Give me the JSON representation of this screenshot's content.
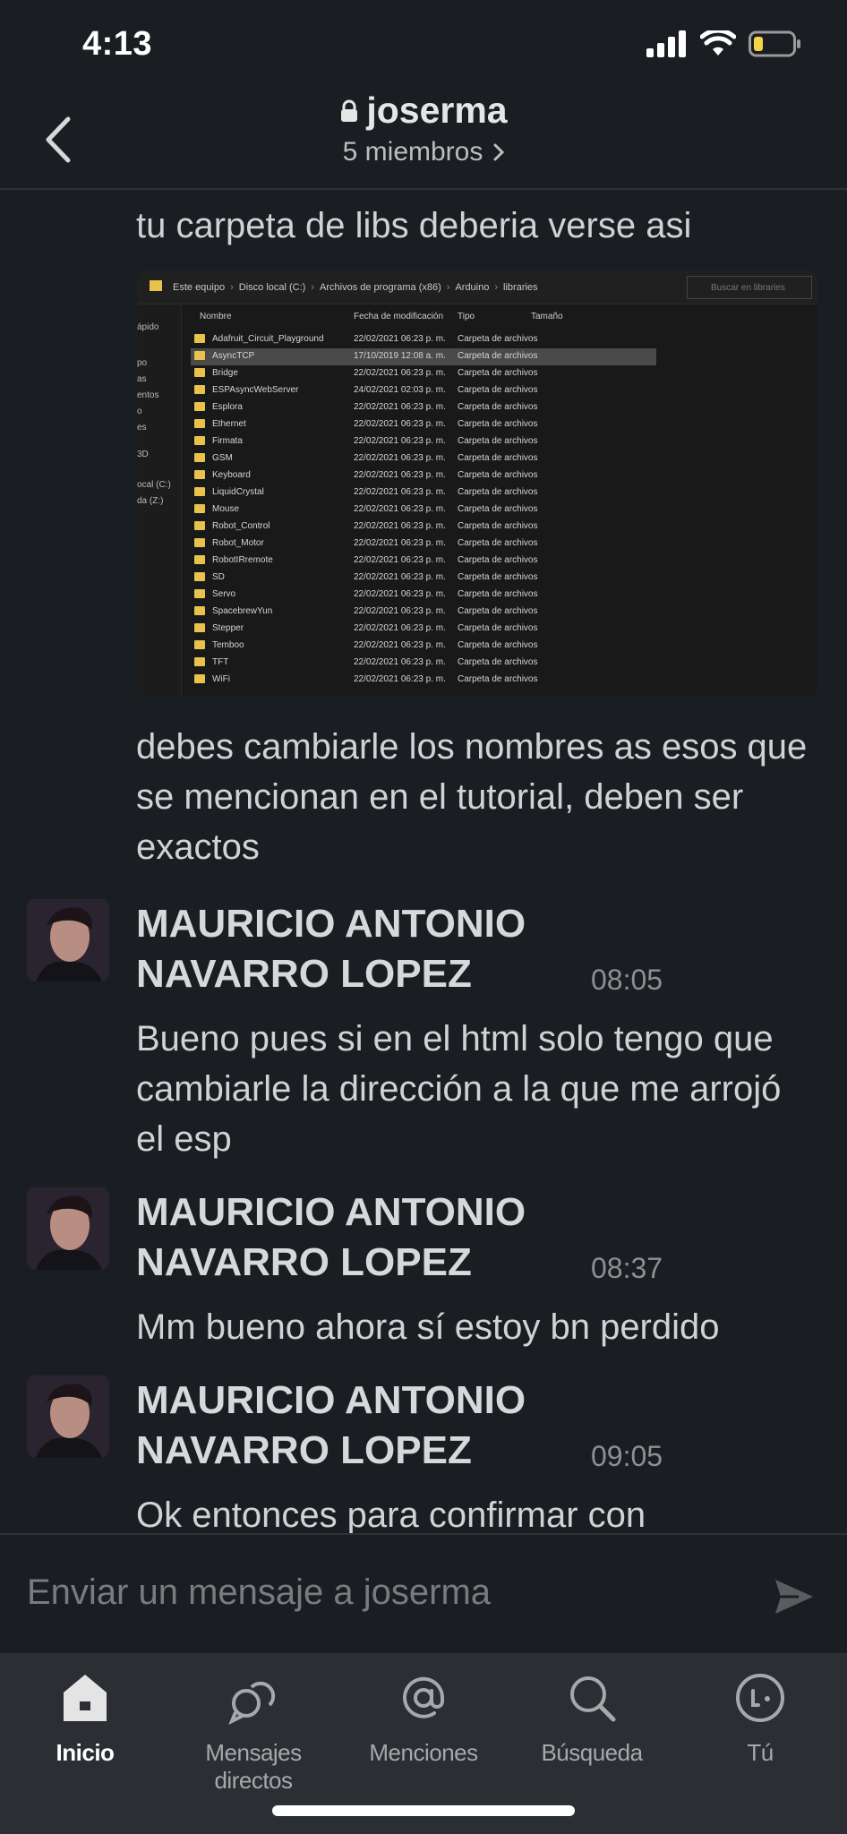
{
  "status_bar": {
    "time": "4:13"
  },
  "header": {
    "channel_name": "joserma",
    "members": "5 miembros"
  },
  "messages": {
    "m1_text": "tu carpeta de libs  deberia verse asi",
    "m2_text": "debes cambiarle los nombres as esos que se mencionan en el tutorial, deben ser exactos",
    "m3": {
      "sender": "MAURICIO ANTONIO NAVARRO LOPEZ",
      "time": "08:05",
      "text": "Bueno pues si en el html solo tengo que cambiarle la dirección a la que me arrojó el esp"
    },
    "m4": {
      "sender": "MAURICIO ANTONIO NAVARRO LOPEZ",
      "time": "08:37",
      "text": "Mm bueno ahora sí estoy bn perdido"
    },
    "m5": {
      "sender": "MAURICIO ANTONIO NAVARRO LOPEZ",
      "time": "09:05",
      "text": "Ok entonces para confirmar con"
    }
  },
  "explorer": {
    "breadcrumb": [
      "Este equipo",
      "Disco local (C:)",
      "Archivos de programa (x86)",
      "Arduino",
      "libraries"
    ],
    "search_placeholder": "Buscar en libraries",
    "nav_items": [
      "ápido",
      "po",
      "as",
      "entos",
      "o",
      "es",
      "3D",
      "ocal (C:)",
      "da (Z:)"
    ],
    "columns": [
      "Nombre",
      "Fecha de modificación",
      "Tipo",
      "Tamaño"
    ],
    "rows": [
      {
        "name": "Adafruit_Circuit_Playground",
        "date": "22/02/2021 06:23 p. m.",
        "type": "Carpeta de archivos"
      },
      {
        "name": "AsyncTCP",
        "date": "17/10/2019 12:08 a. m.",
        "type": "Carpeta de archivos"
      },
      {
        "name": "Bridge",
        "date": "22/02/2021 06:23 p. m.",
        "type": "Carpeta de archivos"
      },
      {
        "name": "ESPAsyncWebServer",
        "date": "24/02/2021 02:03 p. m.",
        "type": "Carpeta de archivos"
      },
      {
        "name": "Esplora",
        "date": "22/02/2021 06:23 p. m.",
        "type": "Carpeta de archivos"
      },
      {
        "name": "Ethernet",
        "date": "22/02/2021 06:23 p. m.",
        "type": "Carpeta de archivos"
      },
      {
        "name": "Firmata",
        "date": "22/02/2021 06:23 p. m.",
        "type": "Carpeta de archivos"
      },
      {
        "name": "GSM",
        "date": "22/02/2021 06:23 p. m.",
        "type": "Carpeta de archivos"
      },
      {
        "name": "Keyboard",
        "date": "22/02/2021 06:23 p. m.",
        "type": "Carpeta de archivos"
      },
      {
        "name": "LiquidCrystal",
        "date": "22/02/2021 06:23 p. m.",
        "type": "Carpeta de archivos"
      },
      {
        "name": "Mouse",
        "date": "22/02/2021 06:23 p. m.",
        "type": "Carpeta de archivos"
      },
      {
        "name": "Robot_Control",
        "date": "22/02/2021 06:23 p. m.",
        "type": "Carpeta de archivos"
      },
      {
        "name": "Robot_Motor",
        "date": "22/02/2021 06:23 p. m.",
        "type": "Carpeta de archivos"
      },
      {
        "name": "RobotIRremote",
        "date": "22/02/2021 06:23 p. m.",
        "type": "Carpeta de archivos"
      },
      {
        "name": "SD",
        "date": "22/02/2021 06:23 p. m.",
        "type": "Carpeta de archivos"
      },
      {
        "name": "Servo",
        "date": "22/02/2021 06:23 p. m.",
        "type": "Carpeta de archivos"
      },
      {
        "name": "SpacebrewYun",
        "date": "22/02/2021 06:23 p. m.",
        "type": "Carpeta de archivos"
      },
      {
        "name": "Stepper",
        "date": "22/02/2021 06:23 p. m.",
        "type": "Carpeta de archivos"
      },
      {
        "name": "Temboo",
        "date": "22/02/2021 06:23 p. m.",
        "type": "Carpeta de archivos"
      },
      {
        "name": "TFT",
        "date": "22/02/2021 06:23 p. m.",
        "type": "Carpeta de archivos"
      },
      {
        "name": "WiFi",
        "date": "22/02/2021 06:23 p. m.",
        "type": "Carpeta de archivos"
      }
    ],
    "selected_row": 1
  },
  "composer": {
    "placeholder": "Enviar un mensaje a joserma"
  },
  "tabs": [
    {
      "label": "Inicio",
      "icon": "home-icon",
      "active": true
    },
    {
      "label": "Mensajes directos",
      "icon": "direct-messages-icon",
      "active": false
    },
    {
      "label": "Menciones",
      "icon": "mentions-icon",
      "active": false
    },
    {
      "label": "Búsqueda",
      "icon": "search-icon",
      "active": false
    },
    {
      "label": "Tú",
      "icon": "profile-icon",
      "active": false
    }
  ],
  "colors": {
    "background": "#1a1d21",
    "tabbar": "#2b2e33",
    "battery": "#f5d547"
  }
}
